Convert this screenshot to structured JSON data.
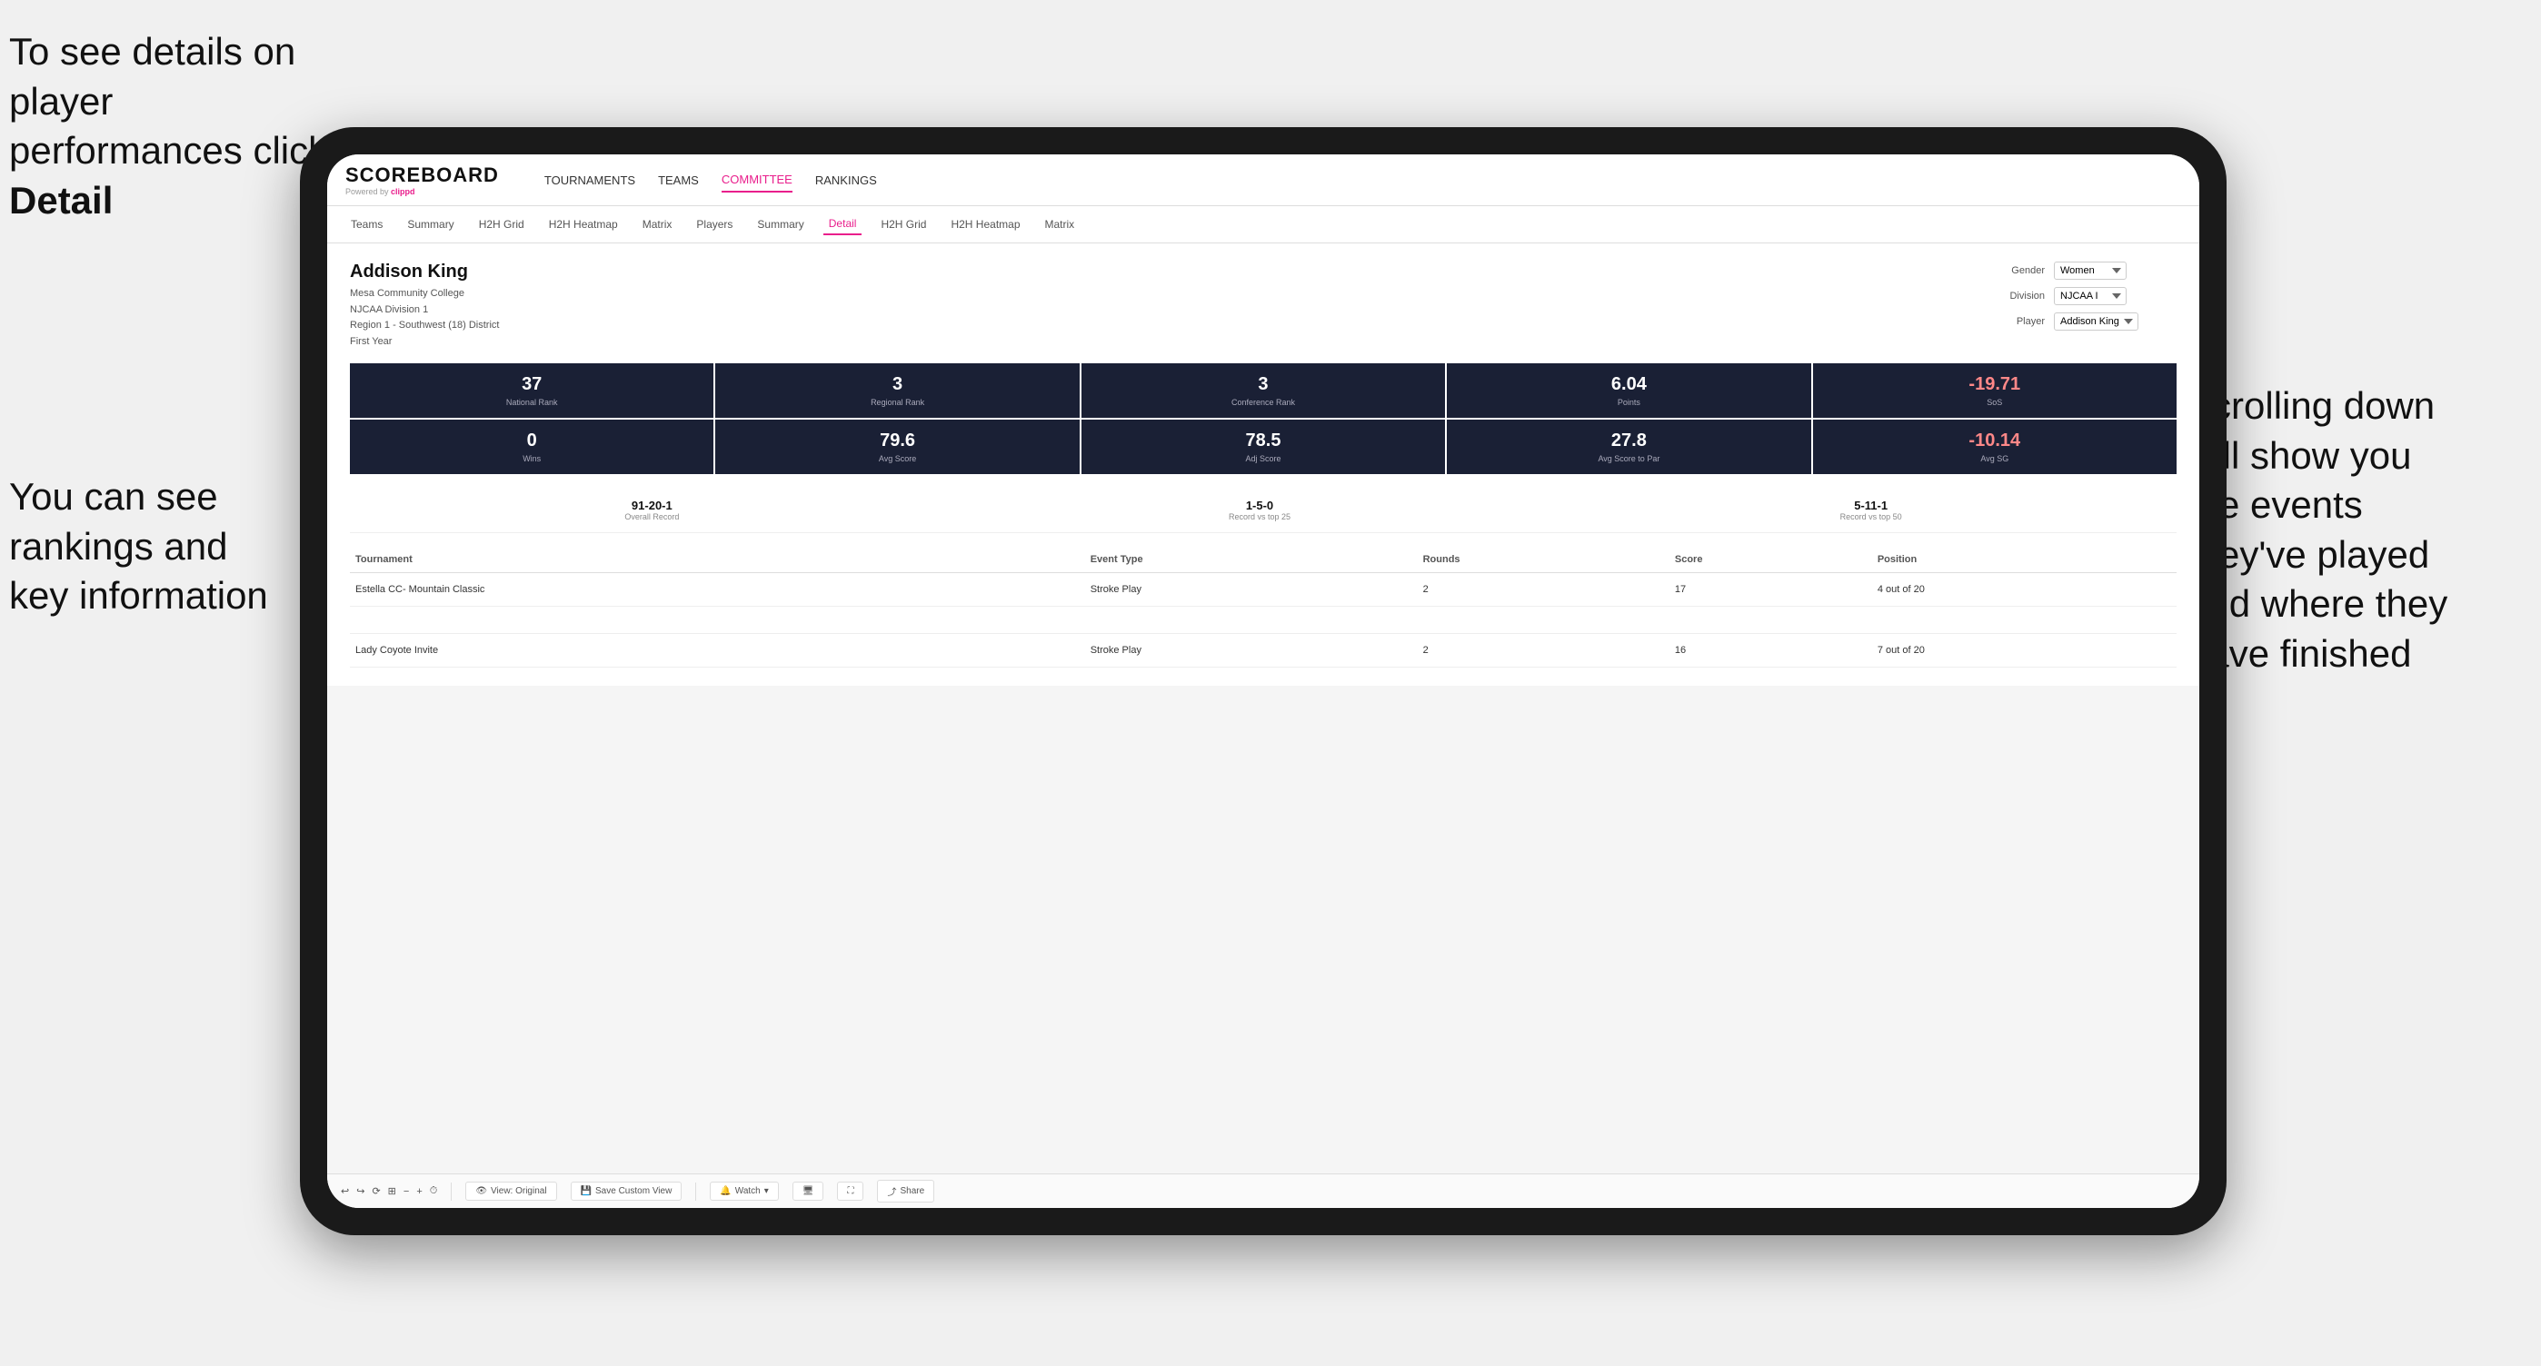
{
  "annotations": {
    "top_left": "To see details on player performances click",
    "top_left_bold": "Detail",
    "bottom_left_line1": "You can see",
    "bottom_left_line2": "rankings and",
    "bottom_left_line3": "key information",
    "right_line1": "Scrolling down",
    "right_line2": "will show you",
    "right_line3": "the events",
    "right_line4": "they've played",
    "right_line5": "and where they",
    "right_line6": "have finished"
  },
  "app": {
    "logo": "SCOREBOARD",
    "powered_by": "Powered by",
    "clippd": "clippd",
    "nav": {
      "items": [
        {
          "label": "TOURNAMENTS",
          "active": false
        },
        {
          "label": "TEAMS",
          "active": false
        },
        {
          "label": "COMMITTEE",
          "active": false
        },
        {
          "label": "RANKINGS",
          "active": false
        }
      ]
    },
    "sub_nav": {
      "items": [
        {
          "label": "Teams",
          "active": false
        },
        {
          "label": "Summary",
          "active": false
        },
        {
          "label": "H2H Grid",
          "active": false
        },
        {
          "label": "H2H Heatmap",
          "active": false
        },
        {
          "label": "Matrix",
          "active": false
        },
        {
          "label": "Players",
          "active": false
        },
        {
          "label": "Summary",
          "active": false
        },
        {
          "label": "Detail",
          "active": true
        },
        {
          "label": "H2H Grid",
          "active": false
        },
        {
          "label": "H2H Heatmap",
          "active": false
        },
        {
          "label": "Matrix",
          "active": false
        }
      ]
    }
  },
  "player": {
    "name": "Addison King",
    "college": "Mesa Community College",
    "division": "NJCAA Division 1",
    "region": "Region 1 - Southwest (18) District",
    "year": "First Year"
  },
  "controls": {
    "gender_label": "Gender",
    "gender_value": "Women",
    "division_label": "Division",
    "division_value": "NJCAA I",
    "player_label": "Player",
    "player_value": "Addison King"
  },
  "stats": [
    {
      "value": "37",
      "label": "National Rank",
      "negative": false
    },
    {
      "value": "3",
      "label": "Regional Rank",
      "negative": false
    },
    {
      "value": "3",
      "label": "Conference Rank",
      "negative": false
    },
    {
      "value": "6.04",
      "label": "Points",
      "negative": false
    },
    {
      "value": "-19.71",
      "label": "SoS",
      "negative": true
    }
  ],
  "stats2": [
    {
      "value": "0",
      "label": "Wins",
      "negative": false
    },
    {
      "value": "79.6",
      "label": "Avg Score",
      "negative": false
    },
    {
      "value": "78.5",
      "label": "Adj Score",
      "negative": false
    },
    {
      "value": "27.8",
      "label": "Avg Score to Par",
      "negative": false
    },
    {
      "value": "-10.14",
      "label": "Avg SG",
      "negative": true
    }
  ],
  "records": [
    {
      "value": "91-20-1",
      "label": "Overall Record"
    },
    {
      "value": "1-5-0",
      "label": "Record vs top 25"
    },
    {
      "value": "5-11-1",
      "label": "Record vs top 50"
    }
  ],
  "table": {
    "headers": [
      "Tournament",
      "Event Type",
      "Rounds",
      "Score",
      "Position"
    ],
    "rows": [
      {
        "tournament": "Estella CC- Mountain Classic",
        "event_type": "Stroke Play",
        "rounds": "2",
        "score": "17",
        "position": "4 out of 20"
      },
      {
        "tournament": "",
        "event_type": "",
        "rounds": "",
        "score": "",
        "position": ""
      },
      {
        "tournament": "Lady Coyote Invite",
        "event_type": "Stroke Play",
        "rounds": "2",
        "score": "16",
        "position": "7 out of 20"
      }
    ]
  },
  "toolbar": {
    "view_original": "View: Original",
    "save_custom": "Save Custom View",
    "watch": "Watch",
    "share": "Share"
  }
}
